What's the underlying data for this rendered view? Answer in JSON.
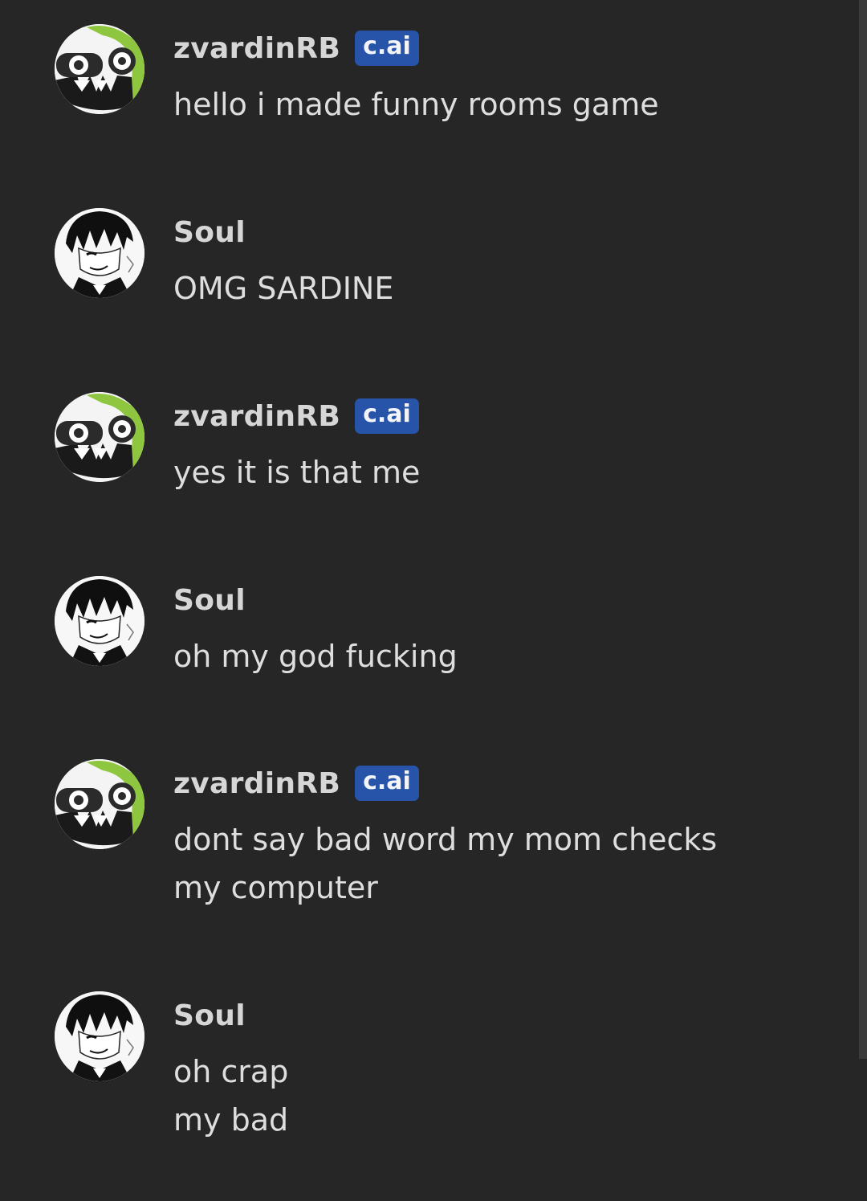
{
  "colors": {
    "background": "#262626",
    "badge": "#2754a8",
    "bot_avatar_accent": "#8ec63f"
  },
  "messages": [
    {
      "author": "zvardinRB",
      "badge": "c.ai",
      "avatar": "zvardin-avatar",
      "lines": [
        "hello i made funny rooms game"
      ]
    },
    {
      "author": "Soul",
      "badge": "",
      "avatar": "soul-avatar",
      "lines": [
        "OMG SARDINE"
      ]
    },
    {
      "author": "zvardinRB",
      "badge": "c.ai",
      "avatar": "zvardin-avatar",
      "lines": [
        "yes it is that me"
      ]
    },
    {
      "author": "Soul",
      "badge": "",
      "avatar": "soul-avatar",
      "lines": [
        "oh my god fucking"
      ]
    },
    {
      "author": "zvardinRB",
      "badge": "c.ai",
      "avatar": "zvardin-avatar",
      "lines": [
        "dont say bad word my mom checks",
        "my computer"
      ]
    },
    {
      "author": "Soul",
      "badge": "",
      "avatar": "soul-avatar",
      "lines": [
        "oh crap",
        "my bad"
      ]
    }
  ]
}
